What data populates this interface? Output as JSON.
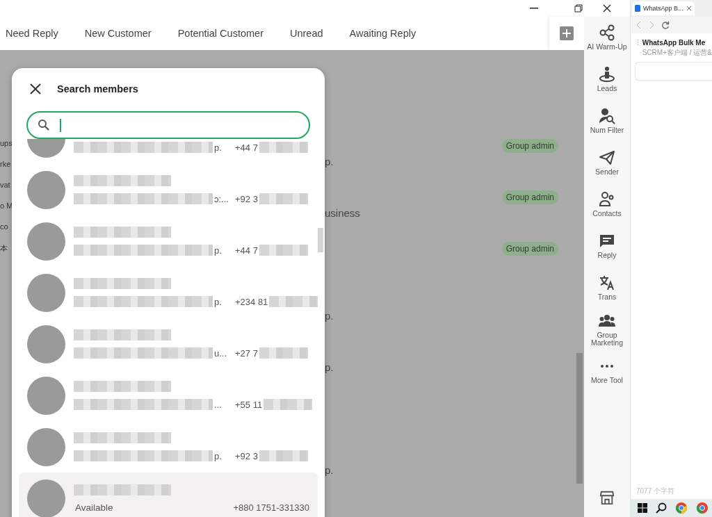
{
  "filter_tabs": [
    {
      "label": "Need Reply",
      "selected": false
    },
    {
      "label": "New Customer",
      "selected": false
    },
    {
      "label": "Potential Customer",
      "selected": false
    },
    {
      "label": "Unread",
      "selected": false
    },
    {
      "label": "Awaiting Reply",
      "selected": false
    }
  ],
  "background_left_fragments": [
    "ups",
    "rke",
    "vat",
    "o M",
    "co",
    "本"
  ],
  "background_rows": [
    {
      "badge": "Group admin",
      "text": "p."
    },
    {
      "badge": "Group admin",
      "text": "usiness"
    },
    {
      "badge": "Group admin"
    },
    {
      "text": "p."
    },
    {
      "text": "p."
    },
    {},
    {
      "text": "p."
    }
  ],
  "dialog": {
    "title": "Search members",
    "members": [
      {
        "kind": "partial",
        "about_tail": "p.",
        "phone": "+44 7",
        "highlighted": false
      },
      {
        "kind": "full",
        "about_tail": "ɔ:...",
        "phone": "+92 3",
        "highlighted": false
      },
      {
        "kind": "full",
        "about_tail": "p.",
        "phone": "+44 7",
        "highlighted": false
      },
      {
        "kind": "full",
        "about_tail": "p.",
        "phone": "+234 81",
        "highlighted": false
      },
      {
        "kind": "full",
        "about_tail": "u...",
        "phone": "+27 7",
        "highlighted": false
      },
      {
        "kind": "full",
        "about_tail": "...",
        "phone": "+55 11",
        "highlighted": false
      },
      {
        "kind": "full",
        "about_tail": "p.",
        "phone": "+92 3",
        "highlighted": false
      },
      {
        "kind": "full",
        "about": "Available",
        "phone": "+880 1751-331330",
        "highlighted": true
      }
    ]
  },
  "sidebar": {
    "items": [
      {
        "label": "AI Warm-Up"
      },
      {
        "label": "Leads"
      },
      {
        "label": "Num Filter"
      },
      {
        "label": "Sender"
      },
      {
        "label": "Contacts"
      },
      {
        "label": "Reply"
      },
      {
        "label": "Trans"
      },
      {
        "label": "Group Marketing"
      },
      {
        "label": "More Tool"
      }
    ]
  },
  "browser": {
    "tab_title": "WhatsApp B...",
    "page_title": "WhatsApp Bulk Me",
    "breadcrumb": "SCRM+客户端 / 运营&",
    "char_count": "7077 个字符"
  }
}
